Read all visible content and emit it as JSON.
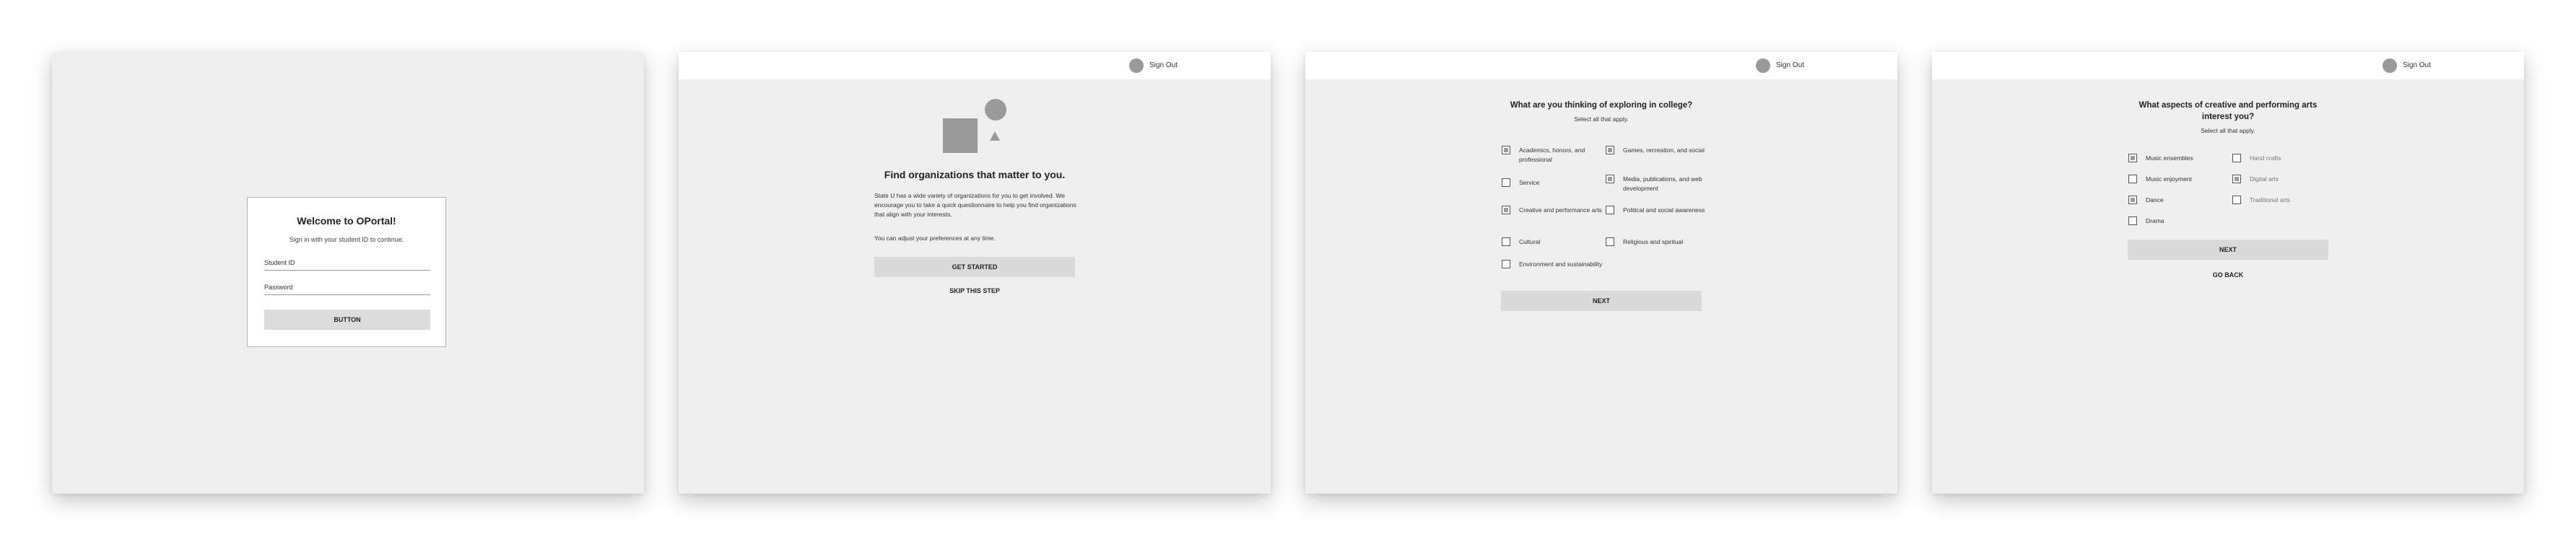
{
  "screen1": {
    "title": "Welcome to OPortal!",
    "subtitle": "Sign in with your student ID to continue.",
    "student_id_label": "Student ID",
    "password_label": "Password",
    "button_label": "BUTTON"
  },
  "topbar": {
    "signout_label": "Sign Out"
  },
  "screen2": {
    "title": "Find organizations that matter to you.",
    "body": "State U has a wide variety of organizations for you to get involved. We encourage you to take a quick questionnaire to help you find organizations that align with your interests.",
    "note": "You can adjust your preferences at any time.",
    "primary_button": "GET STARTED",
    "secondary_button": "SKIP THIS STEP"
  },
  "screen3": {
    "title": "What are you thinking of exploring in college?",
    "subtitle": "Select all that apply.",
    "options": [
      {
        "label": "Academics, honors, and professional",
        "checked": true
      },
      {
        "label": "Games, recreation, and social",
        "checked": true
      },
      {
        "label": "Service",
        "checked": false
      },
      {
        "label": "Media, publications, and web development",
        "checked": true
      },
      {
        "label": "Creative and performance arts",
        "checked": true
      },
      {
        "label": "Political and social awareness",
        "checked": false
      },
      {
        "label": "Cultural",
        "checked": false
      },
      {
        "label": "Religious and spiritual",
        "checked": false
      },
      {
        "label": "Environment and sustainability",
        "checked": false
      }
    ],
    "next_button": "NEXT"
  },
  "screen4": {
    "title_line1": "What aspects of creative and performing arts",
    "title_line2": "interest you?",
    "subtitle": "Select all that apply.",
    "options": [
      {
        "label": "Music ensembles",
        "checked": true
      },
      {
        "label": "Hand crafts",
        "checked": false
      },
      {
        "label": "Music enjoyment",
        "checked": false
      },
      {
        "label": "Digital arts",
        "checked": true
      },
      {
        "label": "Dance",
        "checked": true
      },
      {
        "label": "Traditional arts",
        "checked": false
      },
      {
        "label": "Drama",
        "checked": false
      }
    ],
    "next_button": "NEXT",
    "back_button": "GO BACK"
  }
}
